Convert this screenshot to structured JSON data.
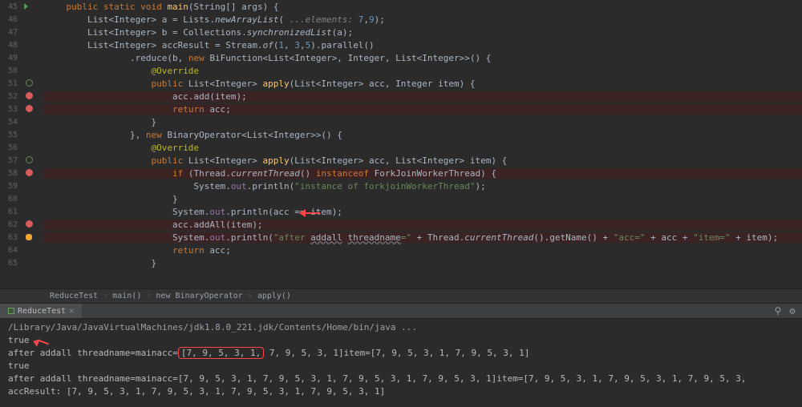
{
  "code_lines": [
    {
      "n": 45,
      "play": true,
      "tokens": [
        "    ",
        [
          "kw",
          "public static void "
        ],
        [
          "method",
          "main"
        ],
        "(",
        [
          "cls",
          "String"
        ],
        "[] ",
        [
          "id",
          "args"
        ],
        ") {"
      ]
    },
    {
      "n": 46,
      "tokens": [
        "        ",
        [
          "cls",
          "List"
        ],
        "<",
        [
          "cls",
          "Integer"
        ],
        "> ",
        [
          "id",
          "a"
        ],
        " = ",
        [
          "cls",
          "Lists"
        ],
        ".",
        [
          "ital",
          "newArrayList"
        ],
        "( ",
        [
          "cmt",
          "...elements: "
        ],
        [
          "num",
          "7"
        ],
        ",",
        [
          "num",
          "9"
        ],
        ");"
      ]
    },
    {
      "n": 47,
      "tokens": [
        "        ",
        [
          "cls",
          "List"
        ],
        "<",
        [
          "cls",
          "Integer"
        ],
        "> ",
        [
          "id",
          "b"
        ],
        " = ",
        [
          "cls",
          "Collections"
        ],
        ".",
        [
          "ital",
          "synchronizedList"
        ],
        "(",
        [
          "id",
          "a"
        ],
        ");"
      ]
    },
    {
      "n": 48,
      "tokens": [
        "        ",
        [
          "cls",
          "List"
        ],
        "<",
        [
          "cls",
          "Integer"
        ],
        "> ",
        [
          "id",
          "accResult"
        ],
        " = ",
        [
          "cls",
          "Stream"
        ],
        ".",
        [
          "ital",
          "of"
        ],
        "(",
        [
          "num",
          "1"
        ],
        ", ",
        [
          "num",
          "3"
        ],
        ",",
        [
          "num",
          "5"
        ],
        ").",
        [
          "id",
          "parallel"
        ],
        "()"
      ]
    },
    {
      "n": 49,
      "tokens": [
        "                .",
        [
          "id",
          "reduce"
        ],
        "(",
        [
          "id",
          "b"
        ],
        ", ",
        [
          "kw",
          "new "
        ],
        [
          "cls",
          "BiFunction"
        ],
        "<",
        [
          "cls",
          "List"
        ],
        "<",
        [
          "cls",
          "Integer"
        ],
        ">, ",
        [
          "cls",
          "Integer"
        ],
        ", ",
        [
          "cls",
          "List"
        ],
        "<",
        [
          "cls",
          "Integer"
        ],
        ">>() {"
      ]
    },
    {
      "n": 50,
      "tokens": [
        "                    ",
        [
          "ann",
          "@Override"
        ]
      ]
    },
    {
      "n": 51,
      "circ": true,
      "tokens": [
        "                    ",
        [
          "kw",
          "public "
        ],
        [
          "cls",
          "List"
        ],
        "<",
        [
          "cls",
          "Integer"
        ],
        "> ",
        [
          "method",
          "apply"
        ],
        "(",
        [
          "cls",
          "List"
        ],
        "<",
        [
          "cls",
          "Integer"
        ],
        "> ",
        [
          "id",
          "acc"
        ],
        ", ",
        [
          "cls",
          "Integer"
        ],
        " ",
        [
          "id",
          "item"
        ],
        ") {"
      ]
    },
    {
      "n": 52,
      "red": true,
      "dot": true,
      "tokens": [
        "                        ",
        [
          "id",
          "acc"
        ],
        ".",
        "add",
        "(",
        [
          "id",
          "item"
        ],
        ");"
      ]
    },
    {
      "n": 53,
      "red": true,
      "dot": true,
      "tokens": [
        "                        ",
        [
          "kw",
          "return "
        ],
        [
          "id",
          "acc"
        ],
        ";"
      ]
    },
    {
      "n": 54,
      "tokens": [
        "                    }"
      ]
    },
    {
      "n": 55,
      "tokens": [
        "                }, ",
        [
          "kw",
          "new "
        ],
        [
          "cls",
          "BinaryOperator"
        ],
        "<",
        [
          "cls",
          "List"
        ],
        "<",
        [
          "cls",
          "Integer"
        ],
        ">>() {"
      ]
    },
    {
      "n": 56,
      "tokens": [
        "                    ",
        [
          "ann",
          "@Override"
        ]
      ]
    },
    {
      "n": 57,
      "circ": true,
      "tokens": [
        "                    ",
        [
          "kw",
          "public "
        ],
        [
          "cls",
          "List"
        ],
        "<",
        [
          "cls",
          "Integer"
        ],
        "> ",
        [
          "method",
          "apply"
        ],
        "(",
        [
          "cls",
          "List"
        ],
        "<",
        [
          "cls",
          "Integer"
        ],
        "> ",
        [
          "id",
          "acc"
        ],
        ", ",
        [
          "cls",
          "List"
        ],
        "<",
        [
          "cls",
          "Integer"
        ],
        "> ",
        [
          "id",
          "item"
        ],
        ") {"
      ]
    },
    {
      "n": 58,
      "red": true,
      "dot": true,
      "tokens": [
        "                        ",
        [
          "kw",
          "if "
        ],
        "(",
        [
          "cls",
          "Thread"
        ],
        ".",
        [
          "ital",
          "currentThread"
        ],
        "() ",
        [
          "kw",
          "instanceof "
        ],
        [
          "cls",
          "ForkJoinWorkerThread"
        ],
        ") {"
      ]
    },
    {
      "n": 59,
      "tokens": [
        "                            ",
        [
          "cls",
          "System"
        ],
        ".",
        [
          "fld",
          "out"
        ],
        ".",
        [
          "id",
          "println"
        ],
        "(",
        [
          "str",
          "\"instance of "
        ],
        [
          "str",
          "forkjoinWorkerThread"
        ],
        [
          "str",
          "\""
        ],
        ");"
      ]
    },
    {
      "n": 60,
      "tokens": [
        "                        }"
      ]
    },
    {
      "n": 61,
      "arrow": true,
      "tokens": [
        "                        ",
        [
          "cls",
          "System"
        ],
        ".",
        [
          "fld",
          "out"
        ],
        ".",
        [
          "id",
          "println"
        ],
        "(",
        [
          "id",
          "acc"
        ],
        " == ",
        [
          "id",
          "item"
        ],
        ");"
      ]
    },
    {
      "n": 62,
      "red": true,
      "dot": true,
      "tokens": [
        "                        ",
        [
          "id",
          "acc"
        ],
        ".",
        "addAll",
        "(",
        [
          "id",
          "item"
        ],
        ");"
      ]
    },
    {
      "n": 63,
      "red": true,
      "bulb": true,
      "tokens": [
        "                        ",
        [
          "cls",
          "System"
        ],
        ".",
        [
          "fld",
          "out"
        ],
        ".",
        [
          "id",
          "println"
        ],
        "(",
        [
          "str",
          "\"after "
        ],
        [
          "warn",
          "addall"
        ],
        [
          "str",
          " "
        ],
        [
          "warn",
          "threadname"
        ],
        [
          "str",
          "=\""
        ],
        " + ",
        [
          "cls",
          "Thread"
        ],
        ".",
        [
          "ital",
          "currentThread"
        ],
        "().",
        [
          "id",
          "getName"
        ],
        "() + ",
        [
          "str",
          "\"acc=\""
        ],
        " + ",
        [
          "id",
          "acc"
        ],
        " + ",
        [
          "str",
          "\"item=\""
        ],
        " + ",
        [
          "id",
          "item"
        ],
        ");"
      ]
    },
    {
      "n": 64,
      "tokens": [
        "                        ",
        [
          "kw",
          "return "
        ],
        [
          "id",
          "acc"
        ],
        ";"
      ]
    },
    {
      "n": 65,
      "tokens": [
        "                    }"
      ]
    }
  ],
  "breadcrumbs": [
    "ReduceTest",
    "main()",
    "new BinaryOperator",
    "apply()"
  ],
  "run_tab": "ReduceTest",
  "console": {
    "cmd": "/Library/Java/JavaVirtualMachines/jdk1.8.0_221.jdk/Contents/Home/bin/java ...",
    "lines": [
      {
        "plain": "true",
        "arrow": true
      },
      {
        "prefix": "after addall threadname=mainacc=",
        "boxed": "[7, 9, 5, 3, 1,",
        "rest": " 7, 9, 5, 3, 1]item=[7, 9, 5, 3, 1, 7, 9, 5, 3, 1]"
      },
      {
        "plain": "true"
      },
      {
        "plain": "after addall threadname=mainacc=[7, 9, 5, 3, 1, 7, 9, 5, 3, 1, 7, 9, 5, 3, 1, 7, 9, 5, 3, 1]item=[7, 9, 5, 3, 1, 7, 9, 5, 3, 1, 7, 9, 5, 3,"
      },
      {
        "plain": "accResult: [7, 9, 5, 3, 1, 7, 9, 5, 3, 1, 7, 9, 5, 3, 1, 7, 9, 5, 3, 1]"
      }
    ]
  }
}
